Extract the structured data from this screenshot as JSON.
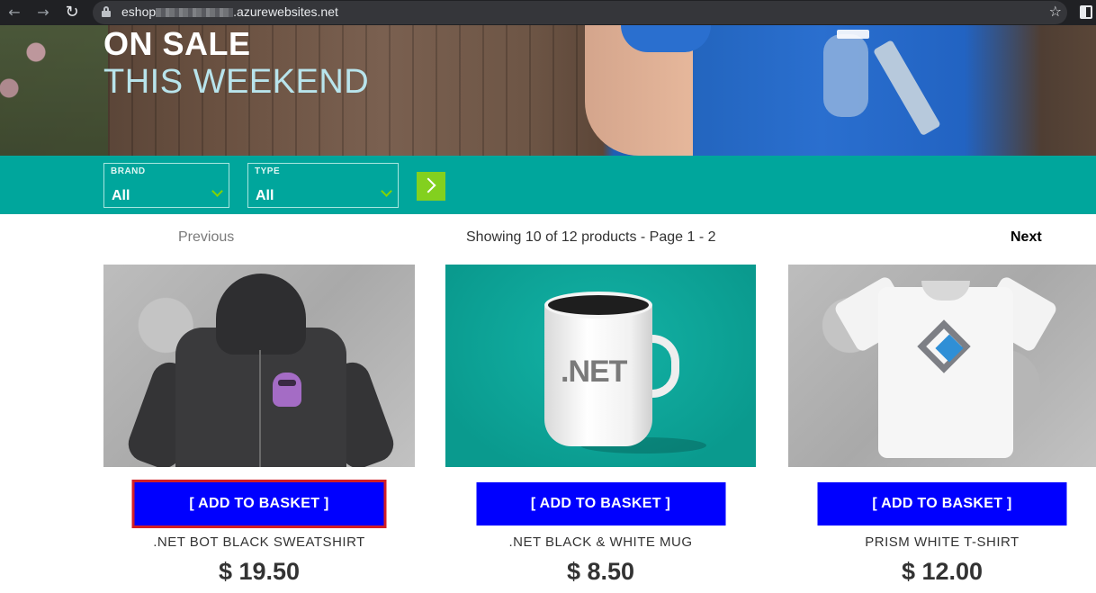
{
  "browser": {
    "url_prefix": "eshop",
    "url_suffix": ".azurewebsites.net"
  },
  "hero": {
    "title": "ON SALE",
    "subtitle": "THIS WEEKEND"
  },
  "filters": {
    "brand": {
      "label": "BRAND",
      "value": "All"
    },
    "type": {
      "label": "TYPE",
      "value": "All"
    }
  },
  "pager": {
    "previous": "Previous",
    "info": "Showing 10 of 12 products - Page 1 - 2",
    "next": "Next"
  },
  "products": [
    {
      "name": ".NET BOT BLACK SWEATSHIRT",
      "price": "$ 19.50",
      "button": "[ ADD TO BASKET ]",
      "image": "hoodie-image"
    },
    {
      "name": ".NET BLACK & WHITE MUG",
      "price": "$ 8.50",
      "button": "[ ADD TO BASKET ]",
      "image": "mug-image",
      "image_text": ".NET"
    },
    {
      "name": "PRISM WHITE T-SHIRT",
      "price": "$ 12.00",
      "button": "[ ADD TO BASKET ]",
      "image": "tshirt-image"
    }
  ],
  "colors": {
    "accent_teal": "#00a69c",
    "button_blue": "#0000ff",
    "go_green": "#83d01f",
    "highlight_red": "#d21f26"
  }
}
